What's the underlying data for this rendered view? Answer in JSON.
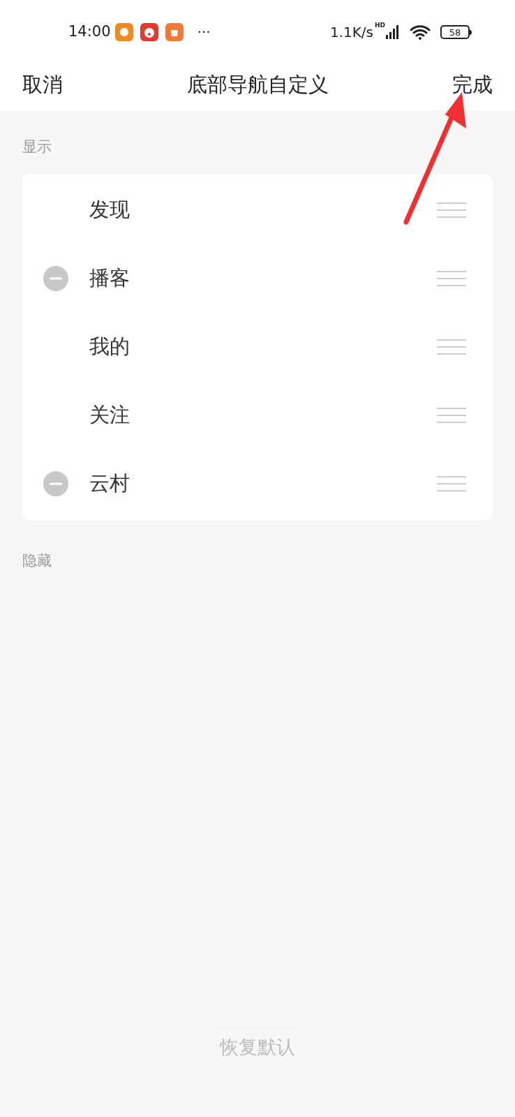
{
  "status_bar": {
    "time": "14:00",
    "more": "···",
    "speed": "1.1K/s",
    "network": "HD",
    "battery": "58"
  },
  "header": {
    "cancel": "取消",
    "title": "底部导航自定义",
    "done": "完成"
  },
  "shown_section": {
    "label": "显示",
    "items": [
      {
        "label": "发现",
        "removable": false
      },
      {
        "label": "播客",
        "removable": true
      },
      {
        "label": "我的",
        "removable": false
      },
      {
        "label": "关注",
        "removable": false
      },
      {
        "label": "云村",
        "removable": true
      }
    ]
  },
  "hidden_section": {
    "label": "隐藏"
  },
  "reset_button": "恢复默认"
}
